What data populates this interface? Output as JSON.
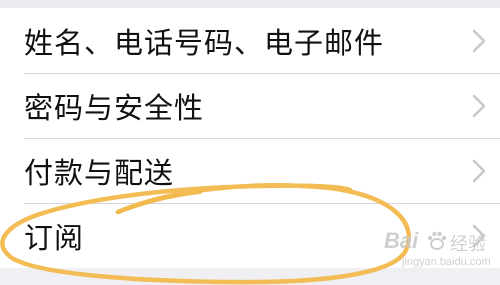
{
  "settings_list": {
    "items": [
      {
        "label": "姓名、电话号码、电子邮件"
      },
      {
        "label": "密码与安全性"
      },
      {
        "label": "付款与配送"
      },
      {
        "label": "订阅"
      }
    ]
  },
  "watermark": {
    "brand": "Bai",
    "brand_suffix": "经验",
    "url": "jingyan.baidu.com"
  },
  "colors": {
    "highlight_stroke": "#f2b84b",
    "chevron": "#c7c7cc",
    "separator": "#d8d8dc",
    "background": "#efeff4"
  },
  "icons": {
    "row_disclosure": "chevron-right-icon"
  }
}
